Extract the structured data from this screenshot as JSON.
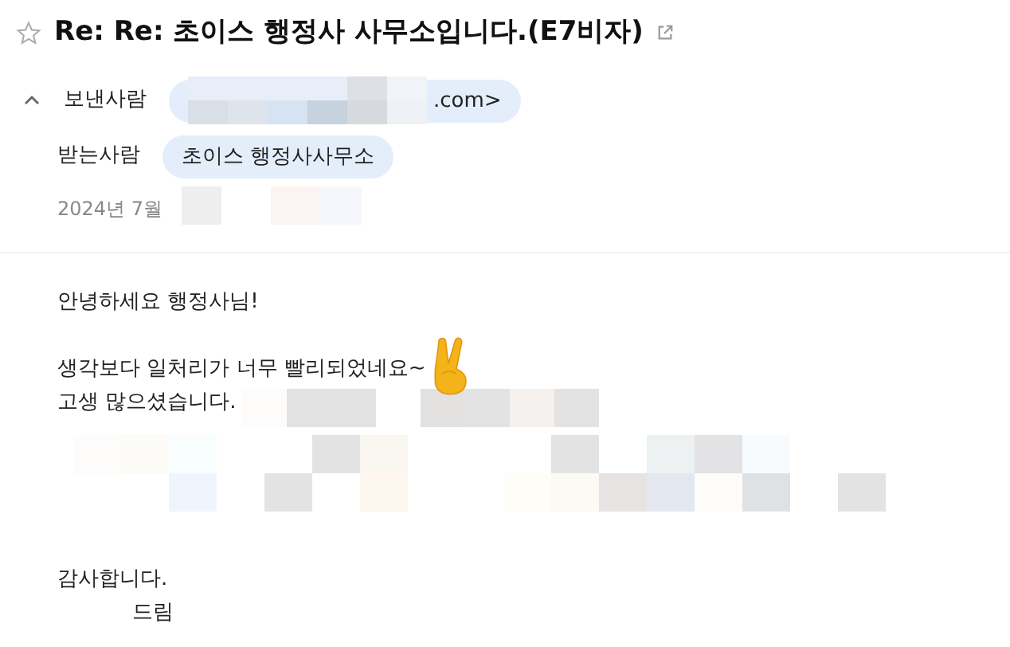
{
  "message": {
    "title": "Re: Re: 초이스 행정사 사무소입니다.(E7비자)",
    "starred": false,
    "details_expanded": true,
    "sender": {
      "label": "보낸사람",
      "chip": ".com>"
    },
    "recipient": {
      "label": "받는사람",
      "chip": "초이스 행정사사무소"
    },
    "date": "2024년 7월",
    "paragraphs": [
      [
        "안녕하세요 행정사님!"
      ],
      [
        "생각보다 일처리가 너무 빨리되었네요~",
        "고생 많으셨습니다."
      ]
    ],
    "closing": "감사합니다.",
    "signature": "드림"
  }
}
